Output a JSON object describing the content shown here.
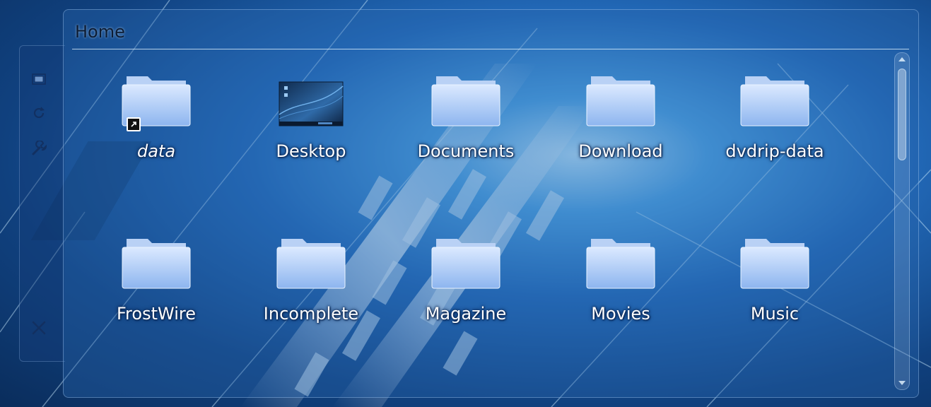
{
  "panel": {
    "title": "Home"
  },
  "toolbox": {
    "tools": [
      {
        "name": "wallpaper-icon"
      },
      {
        "name": "refresh-icon"
      },
      {
        "name": "wrench-icon"
      },
      {
        "name": "close-icon"
      }
    ]
  },
  "items": [
    {
      "label": "data",
      "icon": "folder-link-icon",
      "italic": true
    },
    {
      "label": "Desktop",
      "icon": "desktop-icon"
    },
    {
      "label": "Documents",
      "icon": "folder-icon"
    },
    {
      "label": "Download",
      "icon": "folder-icon"
    },
    {
      "label": "dvdrip-data",
      "icon": "folder-icon"
    },
    {
      "label": "FrostWire",
      "icon": "folder-icon"
    },
    {
      "label": "Incomplete",
      "icon": "folder-icon"
    },
    {
      "label": "Magazine",
      "icon": "folder-icon"
    },
    {
      "label": "Movies",
      "icon": "folder-icon"
    },
    {
      "label": "Music",
      "icon": "folder-icon"
    }
  ],
  "colors": {
    "folder_top": "#d8e8ff",
    "folder_bottom": "#8fb6f0",
    "label_text": "#ffffff",
    "title_text": "#0d1c33"
  }
}
